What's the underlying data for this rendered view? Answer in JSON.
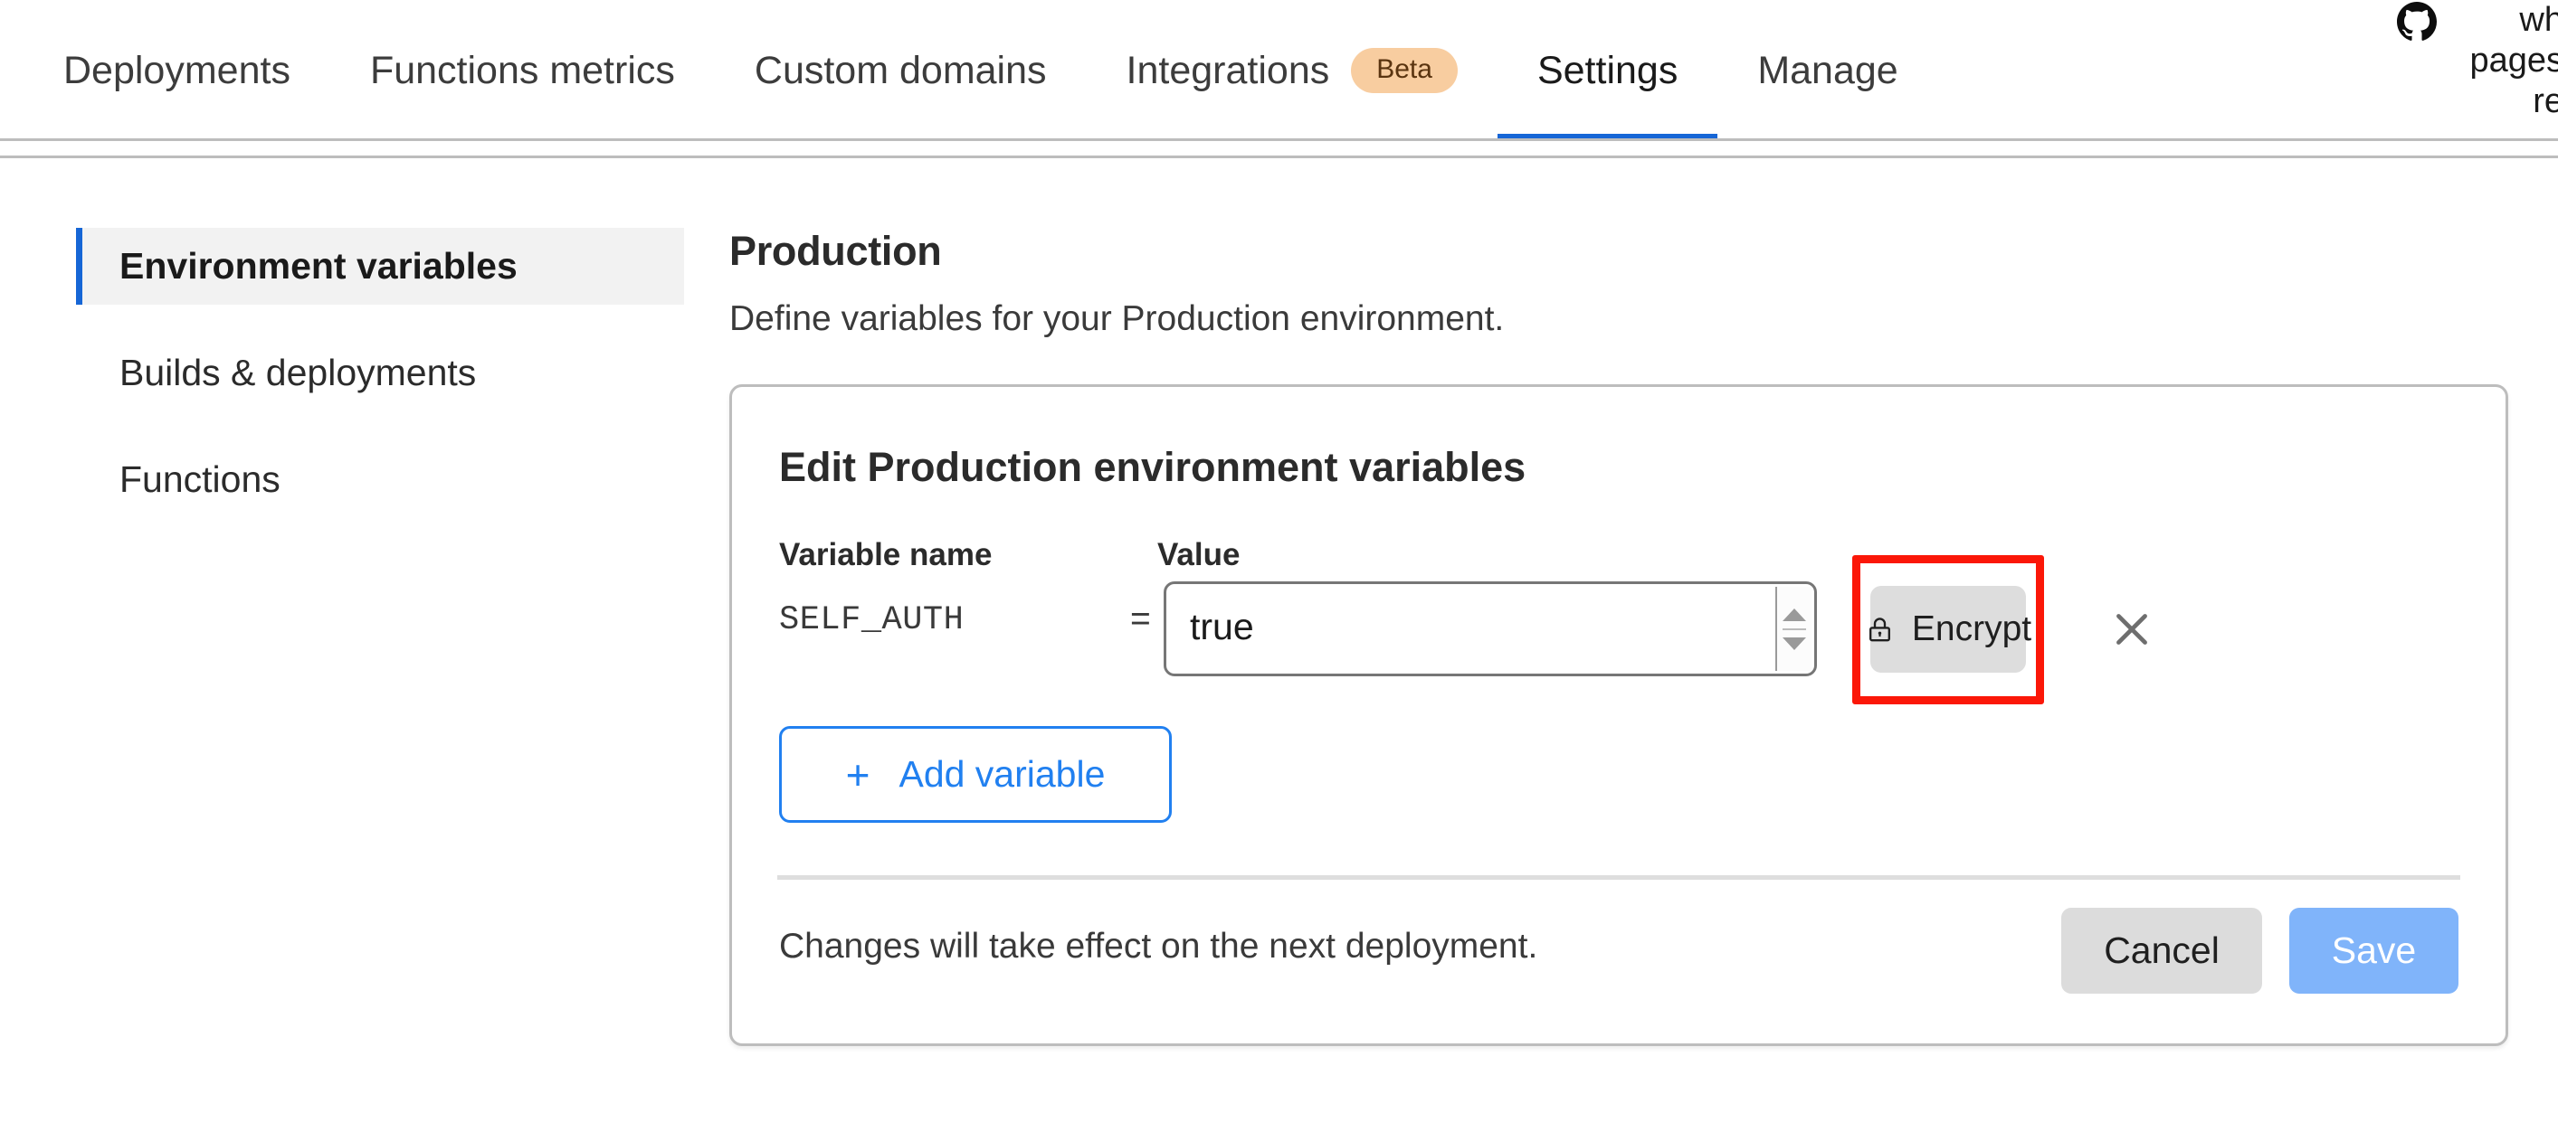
{
  "topnav": {
    "tabs": [
      {
        "label": "Deployments",
        "active": false,
        "badge": null
      },
      {
        "label": "Functions metrics",
        "active": false,
        "badge": null
      },
      {
        "label": "Custom domains",
        "active": false,
        "badge": null
      },
      {
        "label": "Integrations",
        "active": false,
        "badge": "Beta"
      },
      {
        "label": "Settings",
        "active": true,
        "badge": null
      },
      {
        "label": "Manage",
        "active": false,
        "badge": null
      }
    ],
    "active_tab": "Settings",
    "active_underline_color": "#1666d6",
    "beta_badge": {
      "label": "Beta",
      "bg": "#f8cda0",
      "text_color": "#5a3410"
    }
  },
  "corner": {
    "icon": "github-icon",
    "lines": [
      "wh",
      "pages",
      "re"
    ]
  },
  "sidebar": {
    "items": [
      {
        "label": "Environment variables",
        "active": true
      },
      {
        "label": "Builds & deployments",
        "active": false
      },
      {
        "label": "Functions",
        "active": false
      }
    ],
    "active_bg": "#f2f2f2",
    "active_bar_color": "#1666d6"
  },
  "main": {
    "title": "Production",
    "subtitle": "Define variables for your Production environment."
  },
  "card": {
    "title": "Edit Production environment variables",
    "columns": {
      "name": "Variable name",
      "value": "Value"
    },
    "separator": "=",
    "rows": [
      {
        "name": "SELF_AUTH",
        "value": "true",
        "encrypt_label": "Encrypt",
        "encrypt_icon": "lock-icon",
        "remove_icon": "close-icon",
        "highlighted": true,
        "highlight_color": "#fb1708"
      }
    ],
    "add_variable": {
      "label": "Add variable",
      "icon": "plus-icon",
      "color": "#2180f0"
    },
    "footer_note": "Changes will take effect on the next deployment.",
    "cancel_label": "Cancel",
    "save_label": "Save",
    "save_color": "#80b4fa",
    "cancel_color": "#dcdcdc"
  }
}
